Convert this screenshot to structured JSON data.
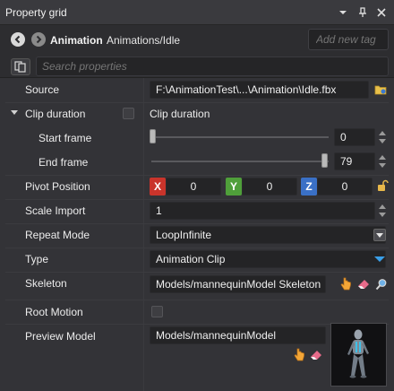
{
  "window": {
    "title": "Property grid"
  },
  "header": {
    "asset_type": "Animation",
    "asset_path": "Animations/Idle",
    "tag_placeholder": "Add new tag"
  },
  "search": {
    "placeholder": "Search properties"
  },
  "properties": {
    "source": {
      "label": "Source",
      "value": "F:\\AnimationTest\\...\\Animation\\Idle.fbx"
    },
    "clip_duration": {
      "label": "Clip duration",
      "checkbox_label": "Clip duration",
      "checked": false,
      "expanded": true
    },
    "start_frame": {
      "label": "Start frame",
      "value": "0",
      "slider_fraction": 0.0
    },
    "end_frame": {
      "label": "End frame",
      "value": "79",
      "slider_fraction": 1.0
    },
    "pivot_position": {
      "label": "Pivot Position",
      "x_tag": "X",
      "x": "0",
      "y_tag": "Y",
      "y": "0",
      "z_tag": "Z",
      "z": "0"
    },
    "scale_import": {
      "label": "Scale Import",
      "value": "1"
    },
    "repeat_mode": {
      "label": "Repeat Mode",
      "value": "LoopInfinite"
    },
    "type": {
      "label": "Type",
      "value": "Animation Clip"
    },
    "skeleton": {
      "label": "Skeleton",
      "value": "Models/mannequinModel Skeleton"
    },
    "root_motion": {
      "label": "Root Motion",
      "checked": false
    },
    "preview_model": {
      "label": "Preview Model",
      "value": "Models/mannequinModel"
    }
  },
  "colors": {
    "axis_x": "#c9342b",
    "axis_y": "#4f9f3a",
    "axis_z": "#3a70c6",
    "accent_blue": "#3a9fe8"
  },
  "icons": [
    "chevron-down-icon",
    "pin-icon",
    "close-icon",
    "back-icon",
    "forward-icon",
    "search-toggle-icon",
    "folder-icon",
    "lock-icon",
    "hand-pointer-icon",
    "eraser-icon",
    "magnifier-icon"
  ]
}
